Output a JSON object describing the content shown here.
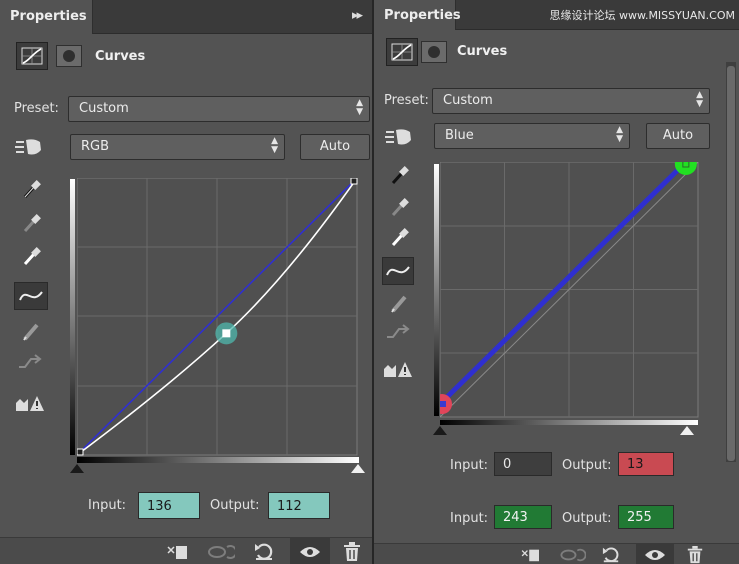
{
  "watermark": "思缘设计论坛 www.MISSYUAN.COM",
  "left": {
    "tab_label": "Properties",
    "collapse_glyph": "▸▸",
    "adjustment_title": "Curves",
    "preset_label": "Preset:",
    "preset_value": "Custom",
    "channel_value": "RGB",
    "auto_label": "Auto",
    "input_label": "Input:",
    "input_value": "136",
    "output_label": "Output:",
    "output_value": "112"
  },
  "right": {
    "tab_label": "Properties",
    "adjustment_title": "Curves",
    "preset_label": "Preset:",
    "preset_value": "Custom",
    "channel_value": "Blue",
    "auto_label": "Auto",
    "input_label_1": "Input:",
    "input_value_1": "0",
    "output_label_1": "Output:",
    "output_value_1": "13",
    "input_label_2": "Input:",
    "input_value_2": "243",
    "output_label_2": "Output:",
    "output_value_2": "255"
  },
  "curves": {
    "left": {
      "channel": "RGB",
      "points": [
        [
          0,
          0
        ],
        [
          136,
          112
        ],
        [
          255,
          255
        ]
      ],
      "blue_points": [
        [
          0,
          0
        ],
        [
          255,
          255
        ]
      ],
      "selected_point": [
        136,
        112
      ]
    },
    "right": {
      "channel": "Blue",
      "points": [
        [
          0,
          13
        ],
        [
          243,
          255
        ]
      ],
      "selected_points": [
        [
          0,
          13
        ],
        [
          243,
          255
        ]
      ]
    }
  },
  "colors": {
    "panel_bg": "#535353",
    "curve_white": "#ffffff",
    "curve_blue": "#2f2fd0",
    "selected_point_teal": "#4fb8ad",
    "point_red": "#e0455a",
    "point_green": "#22e022",
    "field_teal": "#84c8bd",
    "field_red": "#c94a52",
    "field_green": "#217a34"
  },
  "icons": {
    "curves_adjustment": "curves-graph-icon",
    "layer_mask": "layer-mask-icon",
    "on_image_adjust": "hand-target-icon",
    "eyedropper_black": "eyedropper-black-icon",
    "eyedropper_gray": "eyedropper-gray-icon",
    "eyedropper_white": "eyedropper-white-icon",
    "edit_points": "curve-points-icon",
    "draw_curve": "pencil-icon",
    "smooth": "smooth-curve-icon",
    "clipping": "clipping-warning-icon",
    "clip_to_layer": "clip-to-layer-icon",
    "view_previous": "view-previous-icon",
    "reset": "reset-icon",
    "visibility": "eye-icon",
    "delete": "trash-icon"
  }
}
